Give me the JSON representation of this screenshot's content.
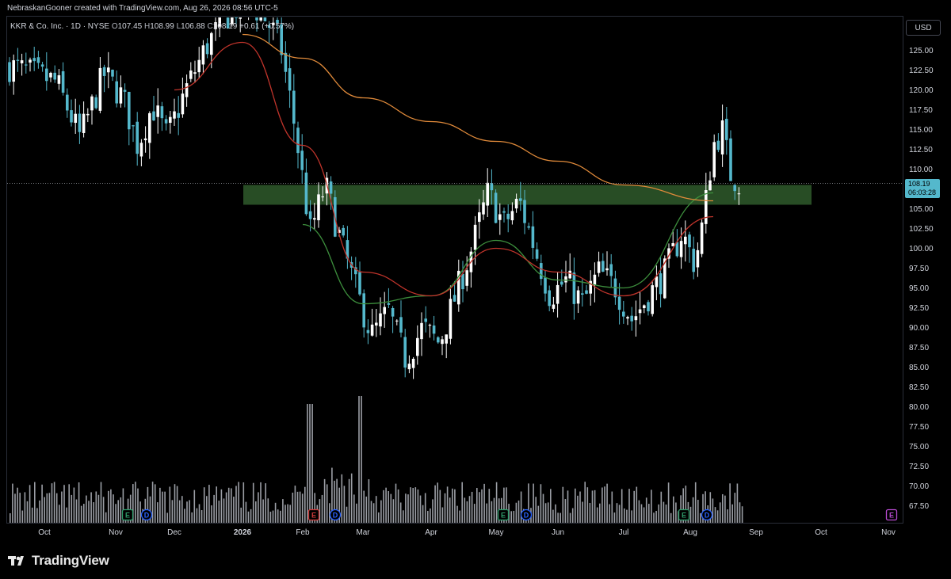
{
  "header": {
    "attribution": "NebraskanGooner created with TradingView.com, Aug 26, 2026 08:56 UTC-5"
  },
  "legend": {
    "symbol": "KKR & Co. Inc. · 1D · NYSE",
    "o_label": "O",
    "o_value": "107.45",
    "h_label": "H",
    "h_value": "108.99",
    "l_label": "L",
    "l_value": "106.88",
    "c_label": "C",
    "c_value": "108.19",
    "change": "+0.61 (+0.57%)"
  },
  "currency_button": "USD",
  "last_price": {
    "price": "108.19",
    "countdown": "06:03:28"
  },
  "footer": {
    "logo_text": "TradingView"
  },
  "colors": {
    "background": "#000000",
    "candle_up": "#ffffff",
    "candle_down": "#54b8cc",
    "sma_fast": "#3d8f3d",
    "sma_mid": "#c0342b",
    "sma_slow": "#e08a3a",
    "zone": "#2f5a2b",
    "volume": "#cfd3dc",
    "earnings_badge": "#2e9c6a",
    "dividend_badge": "#2962ff",
    "earnings_badge_alt": "#d23a3a"
  },
  "chart_data": {
    "type": "candlestick",
    "symbol": "KKR",
    "exchange": "NYSE",
    "interval": "1D",
    "y_axis": {
      "side": "right",
      "ticks": [
        "125.00",
        "122.50",
        "120.00",
        "117.50",
        "115.00",
        "112.50",
        "110.00",
        "107.50",
        "105.00",
        "102.50",
        "100.00",
        "97.50",
        "95.00",
        "92.50",
        "90.00",
        "87.50",
        "85.00",
        "82.50",
        "80.00",
        "77.50",
        "75.00",
        "72.50",
        "70.00",
        "67.50"
      ],
      "ylim": [
        66,
        127
      ]
    },
    "x_axis": {
      "ticks": [
        "Oct",
        "Nov",
        "Dec",
        "2026",
        "Feb",
        "Mar",
        "Apr",
        "May",
        "Jun",
        "Jul",
        "Aug",
        "Sep",
        "Oct",
        "Nov"
      ]
    },
    "last_close": 108.19,
    "last_price_line": 108.19,
    "support_resistance_zone": {
      "low": 105.5,
      "high": 108.0,
      "from": "Jan 2026",
      "to": "Oct 2026"
    },
    "close_path": [
      {
        "t": "Sep 2025",
        "close": 123
      },
      {
        "t": "Oct 2025",
        "close": 121
      },
      {
        "t": "Oct 2025",
        "close": 114
      },
      {
        "t": "Oct 2025",
        "close": 122
      },
      {
        "t": "Nov 2025",
        "close": 119
      },
      {
        "t": "Nov 2025",
        "close": 113
      },
      {
        "t": "Nov 2025",
        "close": 118
      },
      {
        "t": "Nov 2025",
        "close": 114
      },
      {
        "t": "Dec 2025",
        "close": 120
      },
      {
        "t": "Dec 2025",
        "close": 126
      },
      {
        "t": "Dec 2025",
        "close": 130
      },
      {
        "t": "Jan 2026",
        "close": 131
      },
      {
        "t": "Jan 2026",
        "close": 129
      },
      {
        "t": "Jan 2026",
        "close": 126
      },
      {
        "t": "Jan 2026",
        "close": 115
      },
      {
        "t": "Feb 2026",
        "close": 102
      },
      {
        "t": "Feb 2026",
        "close": 108
      },
      {
        "t": "Feb 2026",
        "close": 101
      },
      {
        "t": "Feb 2026",
        "close": 95
      },
      {
        "t": "Mar 2026",
        "close": 89
      },
      {
        "t": "Mar 2026",
        "close": 92
      },
      {
        "t": "Mar 2026",
        "close": 86
      },
      {
        "t": "Mar 2026",
        "close": 90
      },
      {
        "t": "Apr 2026",
        "close": 88
      },
      {
        "t": "Apr 2026",
        "close": 94
      },
      {
        "t": "Apr 2026",
        "close": 100
      },
      {
        "t": "Apr 2026",
        "close": 107
      },
      {
        "t": "May 2026",
        "close": 103
      },
      {
        "t": "May 2026",
        "close": 106
      },
      {
        "t": "May 2026",
        "close": 100
      },
      {
        "t": "May 2026",
        "close": 94
      },
      {
        "t": "Jun 2026",
        "close": 96
      },
      {
        "t": "Jun 2026",
        "close": 93
      },
      {
        "t": "Jun 2026",
        "close": 97
      },
      {
        "t": "Jun 2026",
        "close": 95
      },
      {
        "t": "Jul 2026",
        "close": 91
      },
      {
        "t": "Jul 2026",
        "close": 94
      },
      {
        "t": "Jul 2026",
        "close": 97
      },
      {
        "t": "Jul 2026",
        "close": 102
      },
      {
        "t": "Aug 2026",
        "close": 98
      },
      {
        "t": "Aug 2026",
        "close": 104
      },
      {
        "t": "Aug 2026",
        "close": 113
      },
      {
        "t": "Aug 2026",
        "close": 115
      },
      {
        "t": "Aug 2026",
        "close": 109
      },
      {
        "t": "Aug 2026",
        "close": 108.19
      }
    ],
    "moving_averages": [
      {
        "name": "SMA fast",
        "color": "#3d8f3d",
        "values": [
          {
            "t": "Feb 2026",
            "v": 103
          },
          {
            "t": "Mar 2026",
            "v": 93
          },
          {
            "t": "Apr 2026",
            "v": 94
          },
          {
            "t": "May 2026",
            "v": 101
          },
          {
            "t": "Jun 2026",
            "v": 96
          },
          {
            "t": "Jul 2026",
            "v": 95
          },
          {
            "t": "Aug 2026",
            "v": 107
          }
        ]
      },
      {
        "name": "SMA mid",
        "color": "#c0342b",
        "values": [
          {
            "t": "Dec 2025",
            "v": 120
          },
          {
            "t": "Jan 2026",
            "v": 126
          },
          {
            "t": "Feb 2026",
            "v": 113
          },
          {
            "t": "Mar 2026",
            "v": 97
          },
          {
            "t": "Apr 2026",
            "v": 94
          },
          {
            "t": "May 2026",
            "v": 100
          },
          {
            "t": "Jun 2026",
            "v": 97
          },
          {
            "t": "Jul 2026",
            "v": 94
          },
          {
            "t": "Aug 2026",
            "v": 104
          }
        ]
      },
      {
        "name": "SMA slow",
        "color": "#e08a3a",
        "values": [
          {
            "t": "Jan 2026",
            "v": 127
          },
          {
            "t": "Feb 2026",
            "v": 124
          },
          {
            "t": "Mar 2026",
            "v": 119
          },
          {
            "t": "Apr 2026",
            "v": 116
          },
          {
            "t": "May 2026",
            "v": 113.5
          },
          {
            "t": "Jun 2026",
            "v": 111
          },
          {
            "t": "Jul 2026",
            "v": 108
          },
          {
            "t": "Aug 2026",
            "v": 106
          }
        ]
      }
    ],
    "events": [
      {
        "type": "E",
        "month": "Nov"
      },
      {
        "type": "D",
        "month": "Nov"
      },
      {
        "type": "E",
        "month": "Feb"
      },
      {
        "type": "D",
        "month": "Feb"
      },
      {
        "type": "E",
        "month": "May"
      },
      {
        "type": "D",
        "month": "May"
      },
      {
        "type": "E",
        "month": "Aug"
      },
      {
        "type": "D",
        "month": "Aug"
      },
      {
        "type": "E",
        "month": "Nov"
      }
    ],
    "volume": {
      "shown": true,
      "unit": "relative"
    }
  }
}
